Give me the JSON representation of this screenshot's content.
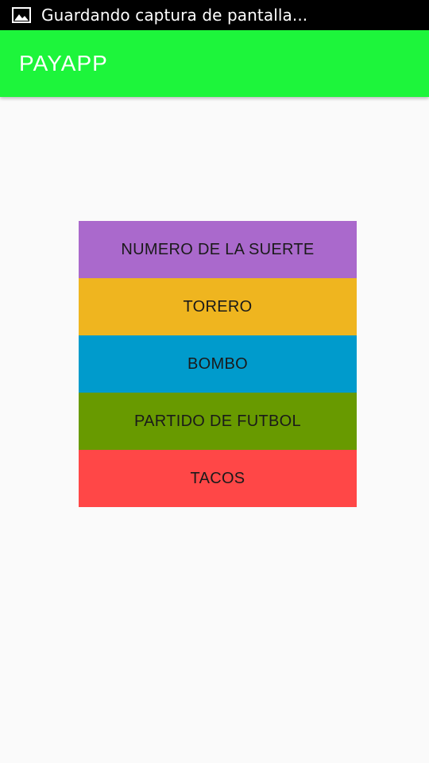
{
  "status_bar": {
    "icon": "image-icon",
    "text": "Guardando captura de pantalla..."
  },
  "app_bar": {
    "title": "PAYAPP",
    "color": "#1df53b"
  },
  "menu": {
    "items": [
      {
        "label": "NUMERO DE LA SUERTE",
        "color": "#aa69cc"
      },
      {
        "label": "TORERO",
        "color": "#efb51f"
      },
      {
        "label": "BOMBO",
        "color": "#009bcc"
      },
      {
        "label": "PARTIDO DE FUTBOL",
        "color": "#689a00"
      },
      {
        "label": "TACOS",
        "color": "#ff4747"
      }
    ]
  }
}
